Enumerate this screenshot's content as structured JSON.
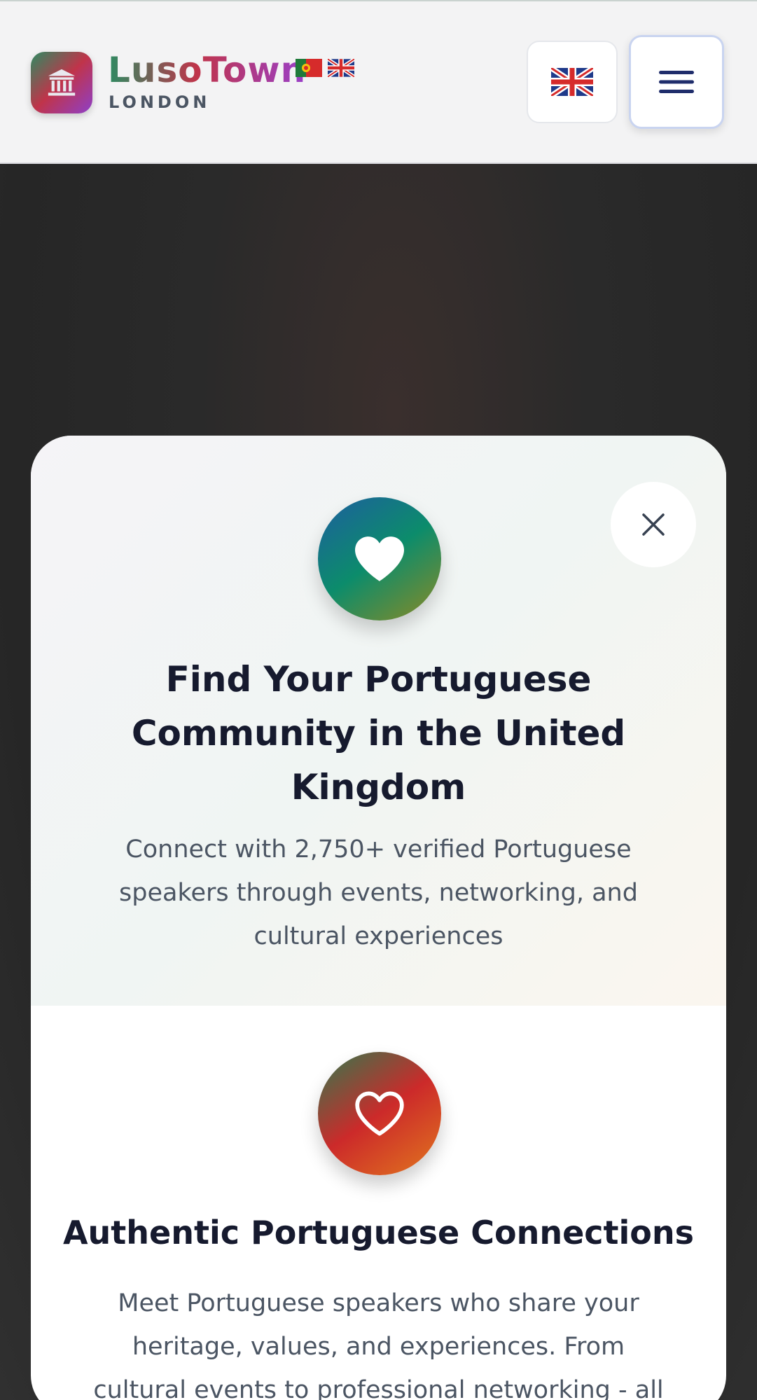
{
  "header": {
    "brand": "LusoTown",
    "sub_brand": "LONDON",
    "language_button_label": "🇬🇧",
    "menu_icon": "hamburger-menu-icon",
    "logo_icon": "building-columns-icon"
  },
  "modal": {
    "heart_icon": "heart-icon",
    "close_icon": "close-icon",
    "title": "Find Your Portuguese Community in the United Kingdom",
    "description": "Connect with 2,750+ verified Portuguese speakers through events, networking, and cultural experiences",
    "feature": {
      "icon": "heart-outline-icon",
      "title": "Authentic Portuguese Connections",
      "description": "Meet Portuguese speakers who share your heritage, values, and experiences. From cultural events to professional networking - all"
    }
  },
  "colors": {
    "brand_green": "#2e8b62",
    "brand_red": "#c0344a",
    "brand_purple": "#8e3fc9",
    "heading": "#161a2e",
    "body_text": "#4b5563"
  }
}
